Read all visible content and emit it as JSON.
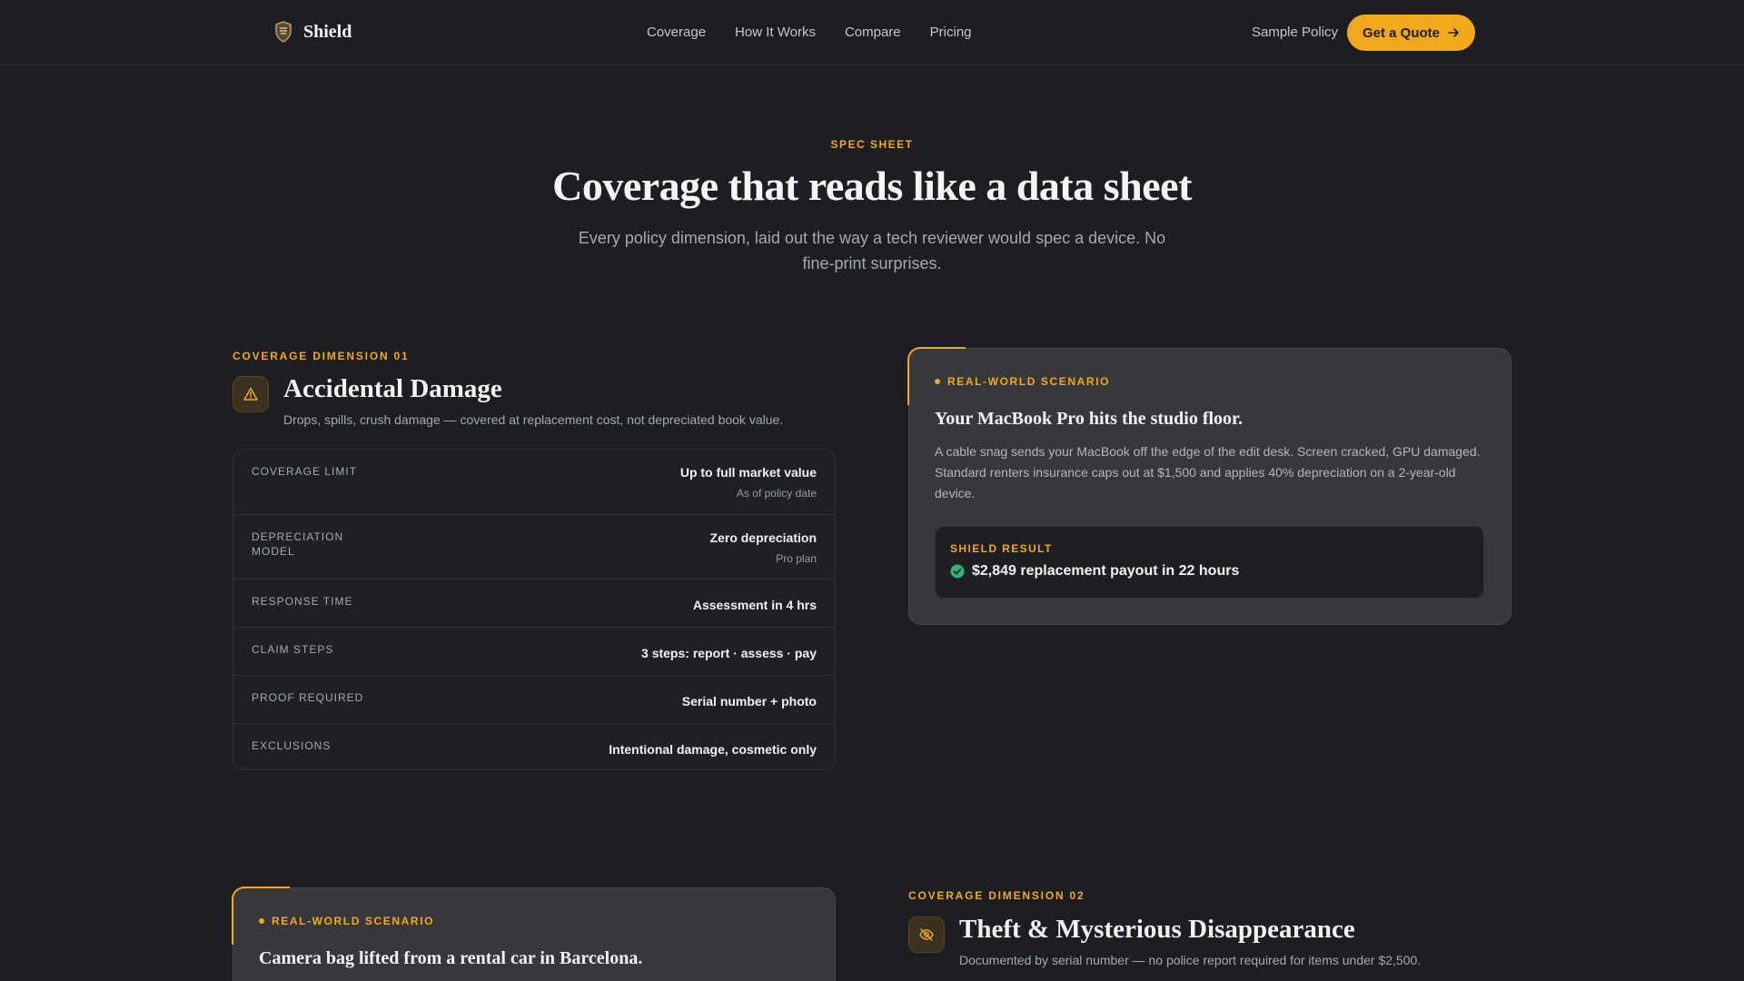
{
  "nav": {
    "brand": "Shield",
    "links": [
      "Coverage",
      "How It Works",
      "Compare",
      "Pricing"
    ],
    "sample_policy": "Sample Policy",
    "quote_button": "Get a Quote"
  },
  "hero": {
    "eyebrow": "SPEC SHEET",
    "title": "Coverage that reads like a data sheet",
    "subtitle": "Every policy dimension, laid out the way a tech reviewer would spec a device. No fine-print surprises."
  },
  "dimension1": {
    "eyebrow": "COVERAGE DIMENSION 01",
    "title": "Accidental Damage",
    "description": "Drops, spills, crush damage — covered at replacement cost, not depreciated book value.",
    "icon": "warning-triangle-icon",
    "rows": [
      {
        "label": "COVERAGE LIMIT",
        "value": "Up to full market value",
        "note": "As of policy date"
      },
      {
        "label": "DEPRECIATION MODEL",
        "value": "Zero depreciation",
        "note": "Pro plan"
      },
      {
        "label": "RESPONSE TIME",
        "value": "Assessment in 4 hrs",
        "note": ""
      },
      {
        "label": "CLAIM STEPS",
        "value": "3 steps: report · assess · pay",
        "note": ""
      },
      {
        "label": "PROOF REQUIRED",
        "value": "Serial number + photo",
        "note": ""
      },
      {
        "label": "EXCLUSIONS",
        "value": "Intentional damage, cosmetic only",
        "note": ""
      }
    ]
  },
  "scenario1": {
    "eyebrow": "REAL-WORLD SCENARIO",
    "title": "Your MacBook Pro hits the studio floor.",
    "body": "A cable snag sends your MacBook off the edge of the edit desk. Screen cracked, GPU damaged. Standard renters insurance caps out at $1,500 and applies 40% depreciation on a 2-year-old device.",
    "result_label": "SHIELD RESULT",
    "result_text": "$2,849 replacement payout in 22 hours"
  },
  "scenario2": {
    "eyebrow": "REAL-WORLD SCENARIO",
    "title": "Camera bag lifted from a rental car in Barcelona."
  },
  "dimension2": {
    "eyebrow": "COVERAGE DIMENSION 02",
    "title": "Theft & Mysterious Disappearance",
    "description": "Documented by serial number — no police report required for items under $2,500.",
    "icon": "eye-off-icon"
  },
  "colors": {
    "accent": "#f2a81d",
    "background": "#1c1e21",
    "card": "#36383c",
    "success": "#2bb673"
  }
}
